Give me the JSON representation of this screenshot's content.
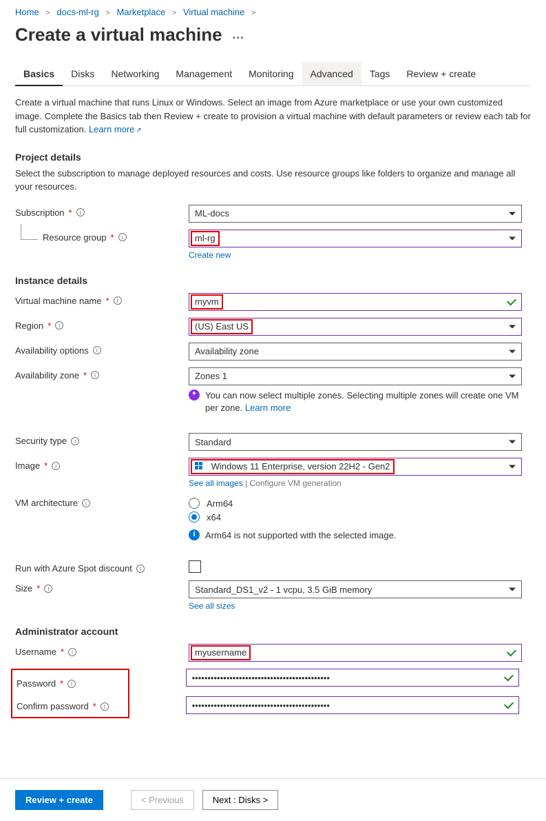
{
  "breadcrumb": {
    "home": "Home",
    "rg": "docs-ml-rg",
    "marketplace": "Marketplace",
    "vm": "Virtual machine"
  },
  "title": "Create a virtual machine",
  "tabs": {
    "basics": "Basics",
    "disks": "Disks",
    "networking": "Networking",
    "management": "Management",
    "monitoring": "Monitoring",
    "advanced": "Advanced",
    "tags": "Tags",
    "review": "Review + create"
  },
  "intro": {
    "text": "Create a virtual machine that runs Linux or Windows. Select an image from Azure marketplace or use your own customized image. Complete the Basics tab then Review + create to provision a virtual machine with default parameters or review each tab for full customization. ",
    "learn_more": "Learn more"
  },
  "project": {
    "title": "Project details",
    "desc": "Select the subscription to manage deployed resources and costs. Use resource groups like folders to organize and manage all your resources.",
    "subscription_label": "Subscription",
    "subscription_value": "ML-docs",
    "rg_label": "Resource group",
    "rg_value": "ml-rg",
    "create_new": "Create new"
  },
  "instance": {
    "title": "Instance details",
    "vmname_label": "Virtual machine name",
    "vmname_value": "myvm",
    "region_label": "Region",
    "region_value": "(US) East US",
    "avail_opt_label": "Availability options",
    "avail_opt_value": "Availability zone",
    "avail_zone_label": "Availability zone",
    "avail_zone_value": "Zones 1",
    "zone_hint": "You can now select multiple zones. Selecting multiple zones will create one VM per zone. ",
    "zone_learn": "Learn more",
    "security_label": "Security type",
    "security_value": "Standard",
    "image_label": "Image",
    "image_value": "Windows 11 Enterprise, version 22H2 - Gen2",
    "see_images": "See all images",
    "configure_gen": "Configure VM generation",
    "arch_label": "VM architecture",
    "arch_arm": "Arm64",
    "arch_x64": "x64",
    "arch_note": "Arm64 is not supported with the selected image.",
    "spot_label": "Run with Azure Spot discount",
    "size_label": "Size",
    "size_value": "Standard_DS1_v2 - 1 vcpu, 3.5 GiB memory",
    "see_sizes": "See all sizes"
  },
  "admin": {
    "title": "Administrator account",
    "user_label": "Username",
    "user_value": "myusername",
    "pass_label": "Password",
    "pass_value": "••••••••••••••••••••••••••••••••••••••••••••",
    "confirm_label": "Confirm password",
    "confirm_value": "••••••••••••••••••••••••••••••••••••••••••••"
  },
  "footer": {
    "review": "Review + create",
    "prev": "< Previous",
    "next": "Next : Disks >"
  }
}
